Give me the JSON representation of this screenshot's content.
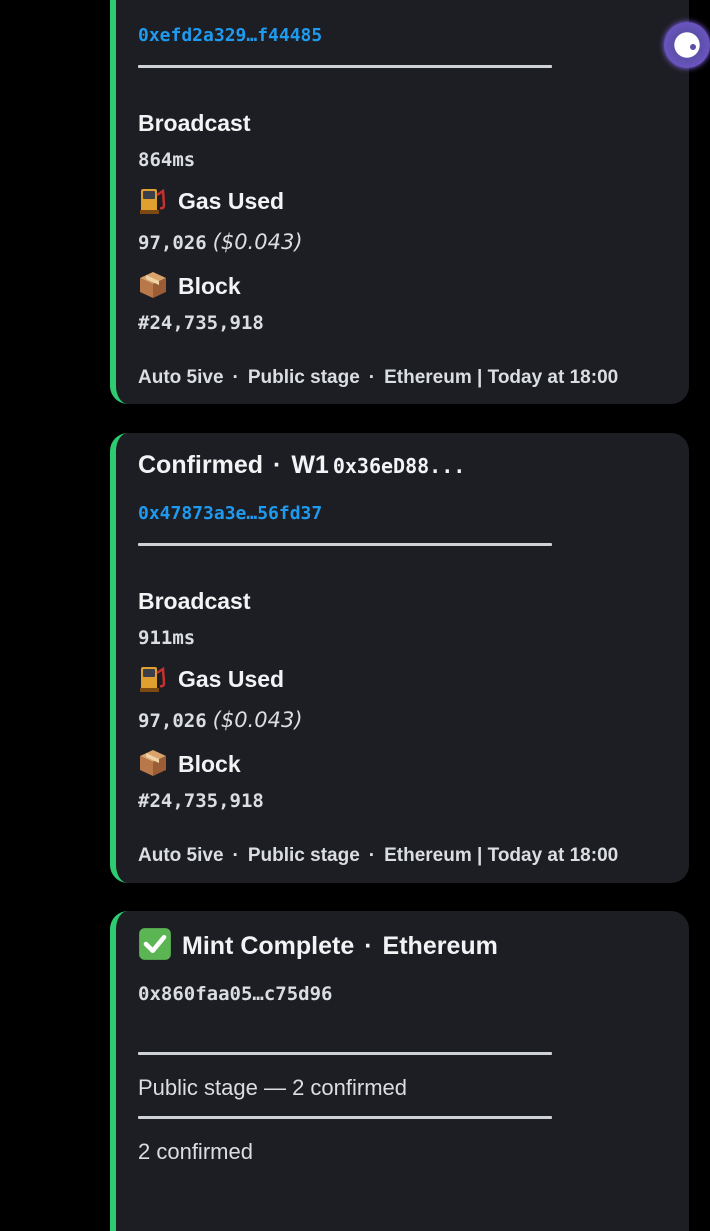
{
  "messages": [
    {
      "tx_hash": "0xefd2a329…f44485",
      "fields": {
        "broadcast_label": "Broadcast",
        "broadcast_value": "864ms",
        "gas_label": "Gas Used",
        "gas_value": "97,026",
        "gas_usd": "($0.043)",
        "block_label": "Block",
        "block_value": "#24,735,918"
      },
      "footer": {
        "bot": "Auto 5ive",
        "stage": "Public stage",
        "chain_time": "Ethereum | Today at 18:00"
      }
    },
    {
      "title": "Confirmed",
      "wallet": "W1",
      "wallet_addr": "0x36eD88...",
      "tx_hash": "0x47873a3e…56fd37",
      "fields": {
        "broadcast_label": "Broadcast",
        "broadcast_value": "911ms",
        "gas_label": "Gas Used",
        "gas_value": "97,026",
        "gas_usd": "($0.043)",
        "block_label": "Block",
        "block_value": "#24,735,918"
      },
      "footer": {
        "bot": "Auto 5ive",
        "stage": "Public stage",
        "chain_time": "Ethereum | Today at 18:00"
      }
    },
    {
      "title": "Mint Complete",
      "chain": "Ethereum",
      "contract": "0x860faa05…c75d96",
      "summary": "Public stage — 2 confirmed",
      "count": "2 confirmed"
    }
  ],
  "separator_dot": "·",
  "icons": {
    "gas": "fuel-pump-icon",
    "block": "package-icon",
    "check": "check-mark-icon"
  },
  "colors": {
    "accent": "#2ecc71",
    "link": "#1e9bf0",
    "embed_bg": "#1d1e23"
  }
}
